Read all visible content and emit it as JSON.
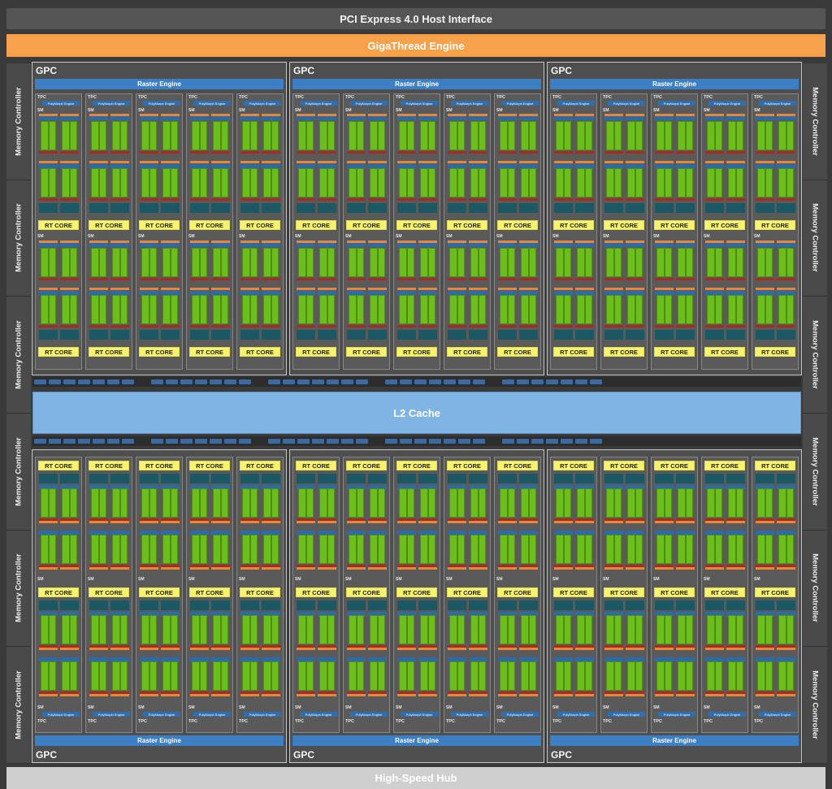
{
  "header": {
    "pcie_label": "PCI Express 4.0 Host Interface",
    "gigathread_label": "GigaThread Engine"
  },
  "footer": {
    "hub_label": "High-Speed Hub"
  },
  "memory_controller_label": "Memory Controller",
  "l2_cache_label": "L2 Cache",
  "gpc_label": "GPC",
  "raster_engine_label": "Raster Engine",
  "tpc_label": "TPC",
  "polymorph_label": "PolyMorph Engine",
  "sm_label": "SM",
  "rt_core_label": "RT CORE",
  "colors": {
    "background": "#3a3a3a",
    "gigathread": "#f7a24a",
    "raster_engine": "#3d7fc4",
    "rt_core": "#f7f36a",
    "cuda_cores": "#6cbf1a",
    "l2_cache": "#7fb4e4",
    "hub": "#cfcfcf"
  },
  "layout": {
    "gpcs_per_half": 3,
    "tpcs_per_gpc": 5,
    "sms_per_tpc": 2,
    "memory_controllers_per_side": 6
  }
}
